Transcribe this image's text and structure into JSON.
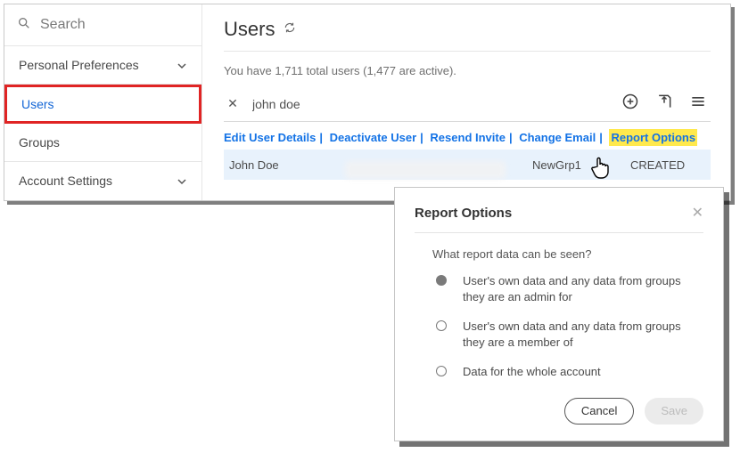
{
  "sidebar": {
    "search_placeholder": "Search",
    "items": [
      {
        "label": "Personal Preferences",
        "expandable": true
      },
      {
        "label": "Users",
        "expandable": false
      },
      {
        "label": "Groups",
        "expandable": false
      },
      {
        "label": "Account Settings",
        "expandable": true
      }
    ],
    "active_index": 1
  },
  "header": {
    "title": "Users"
  },
  "summary": {
    "text": "You have 1,711 total users (1,477 are active)."
  },
  "search": {
    "value": "john doe"
  },
  "action_bar": {
    "links": [
      "Edit User Details",
      "Deactivate User",
      "Resend Invite",
      "Change Email",
      "Report Options"
    ],
    "highlighted_index": 4
  },
  "table": {
    "rows": [
      {
        "name": "John Doe",
        "email_obscured": true,
        "group": "NewGrp1",
        "status": "CREATED"
      }
    ]
  },
  "modal": {
    "title": "Report Options",
    "question": "What report data can be seen?",
    "options": [
      "User's own data and any data from groups they are an admin for",
      "User's own data and any data from groups they are a member of",
      "Data for the whole account"
    ],
    "selected_index": 0,
    "buttons": {
      "cancel": "Cancel",
      "save": "Save"
    }
  }
}
